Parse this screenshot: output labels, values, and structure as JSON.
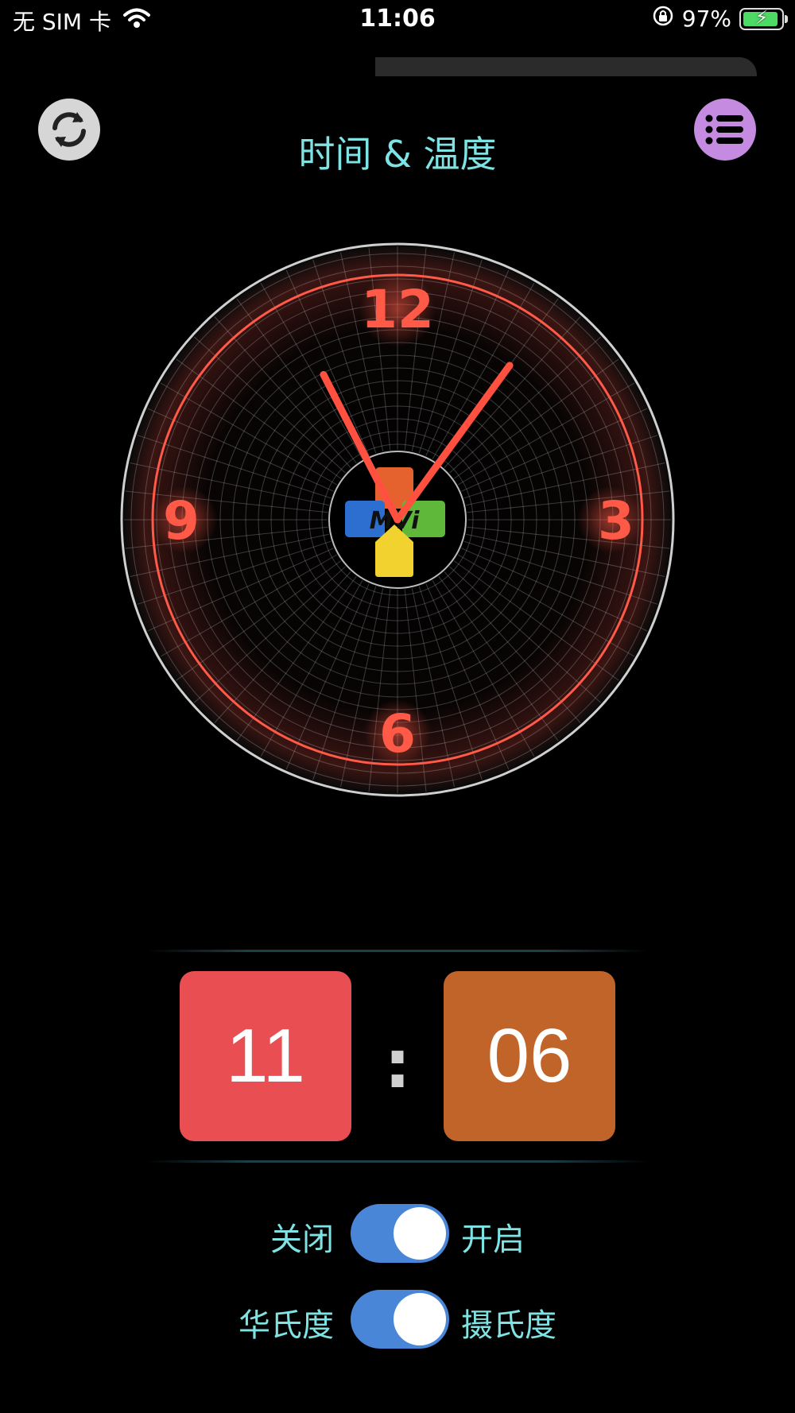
{
  "status_bar": {
    "carrier": "无 SIM 卡",
    "time": "11:06",
    "battery": "97%",
    "battery_level": 0.97
  },
  "header": {
    "title": "时间 & 温度",
    "refresh_icon": "refresh-icon",
    "menu_icon": "list-menu-icon",
    "menu_color": "#c58be0"
  },
  "clock": {
    "numerals": {
      "n12": "12",
      "n3": "3",
      "n6": "6",
      "n9": "9"
    },
    "logo_text": "MVi",
    "hour": 11,
    "minute": 6,
    "accent_color": "#ff5040"
  },
  "digital": {
    "hour": "11",
    "separator": ":",
    "minute": "06"
  },
  "toggles": [
    {
      "left_label": "关闭",
      "right_label": "开启",
      "state": "on"
    },
    {
      "left_label": "华氏度",
      "right_label": "摄氏度",
      "state": "on"
    }
  ]
}
